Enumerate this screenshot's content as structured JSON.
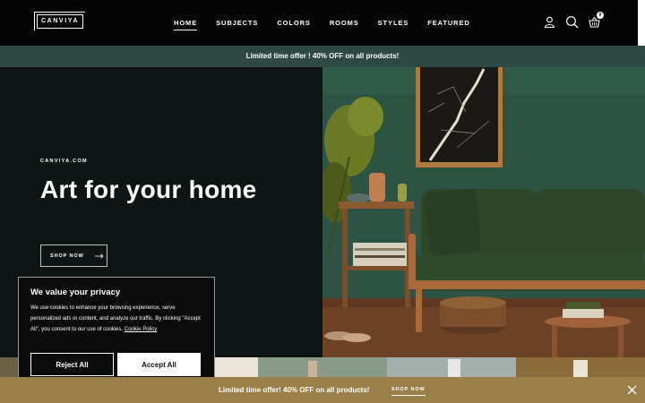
{
  "header": {
    "logo": "CANVIYA",
    "nav": [
      {
        "label": "HOME",
        "active": true
      },
      {
        "label": "SUBJECTS",
        "active": false
      },
      {
        "label": "COLORS",
        "active": false
      },
      {
        "label": "ROOMS",
        "active": false
      },
      {
        "label": "STYLES",
        "active": false
      },
      {
        "label": "FEATURED",
        "active": false
      }
    ],
    "icons": [
      "user-icon",
      "search-icon",
      "cart-icon"
    ],
    "cart_count": "0"
  },
  "promo_top": "Limited time offer ! 40% OFF on all products!",
  "hero": {
    "brand": "CANVIYA.COM",
    "title": "Art for your home",
    "button_label": "SHOP NOW"
  },
  "cookie": {
    "title": "We value your privacy",
    "text": "We use cookies to enhance your browsing experience, serve personalized ads or content, and analyze our traffic. By clicking \"Accept All\", you consent to our use of cookies.",
    "policy_link": "Cookie Policy",
    "reject_label": "Reject All",
    "accept_label": "Accept All"
  },
  "promo_bottom": {
    "text": "Limited time offer! 40% OFF on all products!",
    "link": "SHOP NOW"
  },
  "colors": {
    "promo_top_bg": "#2e4943",
    "promo_bottom_bg": "#9a8048",
    "navbar_bg": "#050505",
    "hero_left_bg": "#0f1414"
  }
}
